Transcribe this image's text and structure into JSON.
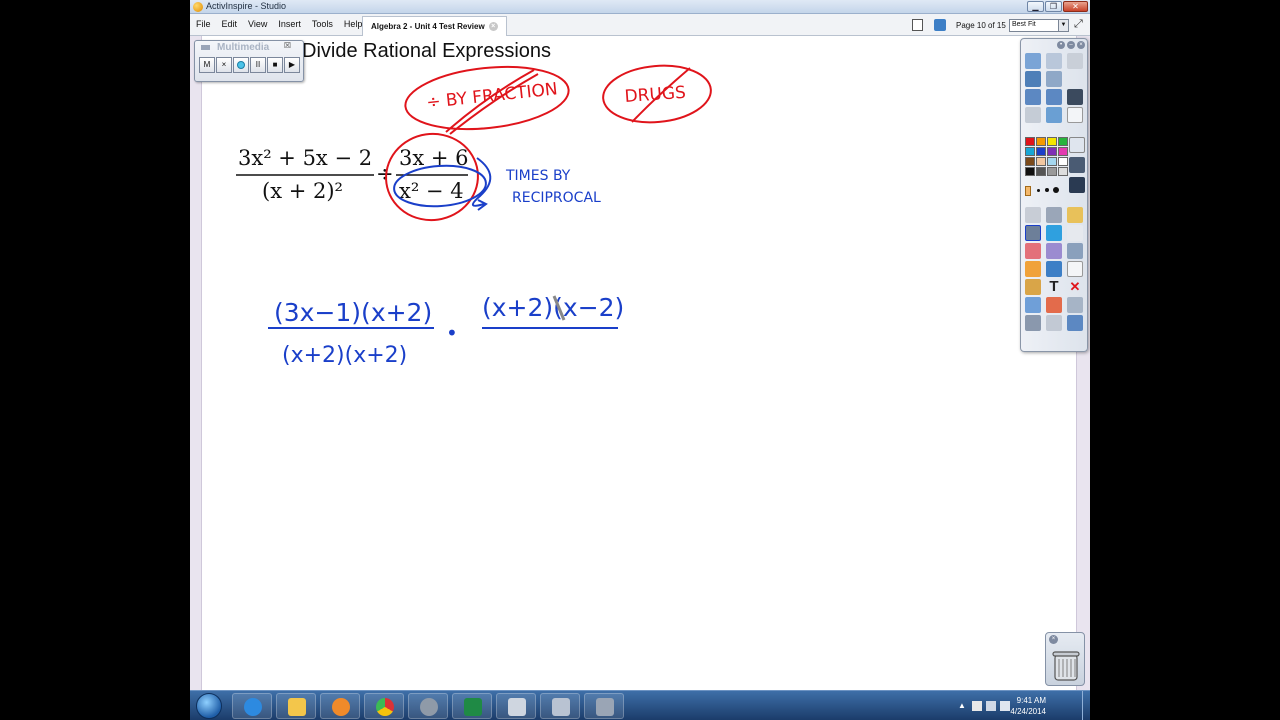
{
  "window": {
    "app_title": "ActivInspire - Studio"
  },
  "menu": {
    "items": [
      "File",
      "Edit",
      "View",
      "Insert",
      "Tools",
      "Help"
    ]
  },
  "document": {
    "tab_label": "Algebra 2 - Unit 4 Test Review",
    "page_indicator": "Page 10 of 15",
    "zoom_value": "Best Fit"
  },
  "canvas": {
    "heading": "Divide Rational Expressions",
    "typed_expression": {
      "left_numerator": "3x² + 5x − 2",
      "left_denominator": "(x + 2)²",
      "operator": "÷",
      "right_numerator": "3x + 6",
      "right_denominator": "x² − 4"
    },
    "handwriting": {
      "red_note_1": "÷ BY FRACTION",
      "red_note_2": "DRUGS",
      "blue_note_line1": "TIMES BY",
      "blue_note_line2": "RECIPROCAL",
      "work_left_numerator": "(3x−1)(x+2)",
      "work_left_denominator": "(x+2)(x+2)",
      "work_dot": "•",
      "work_right_numerator": "(x+2)(x−2)"
    }
  },
  "recorder": {
    "watermark": "Multimedia",
    "close": "☒",
    "buttons": [
      "M",
      "×",
      "",
      "II",
      "■",
      "▶"
    ]
  },
  "toolbox": {
    "header_icons": [
      "gear-icon",
      "minimize-icon",
      "close-icon"
    ]
  },
  "trash": {
    "close": "×"
  },
  "taskbar": {
    "apps": [
      "internet-explorer",
      "file-explorer",
      "media-player",
      "chrome",
      "activinspire",
      "excel",
      "notepad",
      "calculator",
      "fax-printer"
    ],
    "time": "9:41 AM",
    "date": "4/24/2014"
  },
  "colors": {
    "ink_red": "#e0141b",
    "ink_blue": "#1a3fc9",
    "accent": "#3d7fc6"
  }
}
